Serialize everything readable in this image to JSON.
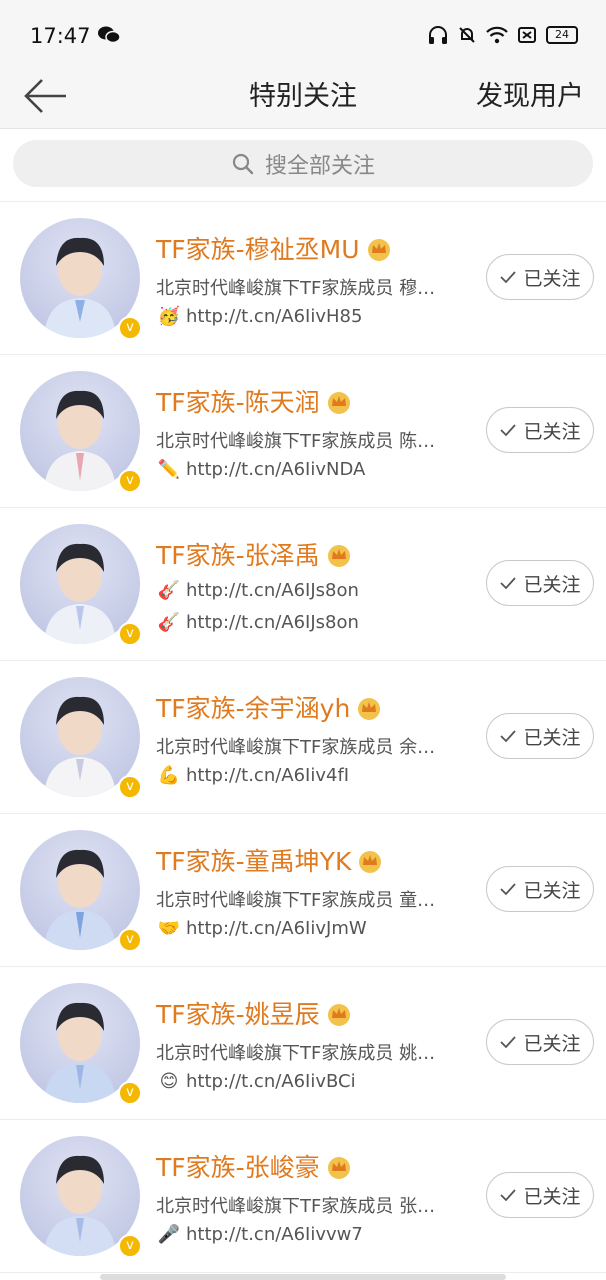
{
  "status_bar": {
    "time": "17:47",
    "battery": "24"
  },
  "header": {
    "title": "特别关注",
    "discover": "发现用户"
  },
  "search": {
    "placeholder": "搜全部关注"
  },
  "follow_label": "已关注",
  "users": [
    {
      "name": "TF家族-穆祉丞MU",
      "line1": "北京时代峰峻旗下TF家族成员 穆…",
      "line2_emoji": "🥳",
      "line2": "http://t.cn/A6IivH85"
    },
    {
      "name": "TF家族-陈天润",
      "line1": "北京时代峰峻旗下TF家族成员 陈…",
      "line2_emoji": "✏️",
      "line2": "http://t.cn/A6IivNDA"
    },
    {
      "name": "TF家族-张泽禹",
      "line1_emoji": "🎸",
      "line1": "http://t.cn/A6IJs8on",
      "line2_emoji": "🎸",
      "line2": "http://t.cn/A6IJs8on"
    },
    {
      "name": "TF家族-余宇涵yh",
      "line1": "北京时代峰峻旗下TF家族成员 余…",
      "line2_emoji": "💪",
      "line2": "http://t.cn/A6Iiv4fI"
    },
    {
      "name": "TF家族-童禹坤YK",
      "line1": "北京时代峰峻旗下TF家族成员 童…",
      "line2_emoji": "🤝",
      "line2": "http://t.cn/A6IivJmW"
    },
    {
      "name": "TF家族-姚昱辰",
      "line1": "北京时代峰峻旗下TF家族成员 姚…",
      "line2_emoji": "😊",
      "line2": "http://t.cn/A6IivBCi"
    },
    {
      "name": "TF家族-张峻豪",
      "line1": "北京时代峰峻旗下TF家族成员 张…",
      "line2_emoji": "🎤",
      "line2": "http://t.cn/A6Iivvw7"
    }
  ]
}
